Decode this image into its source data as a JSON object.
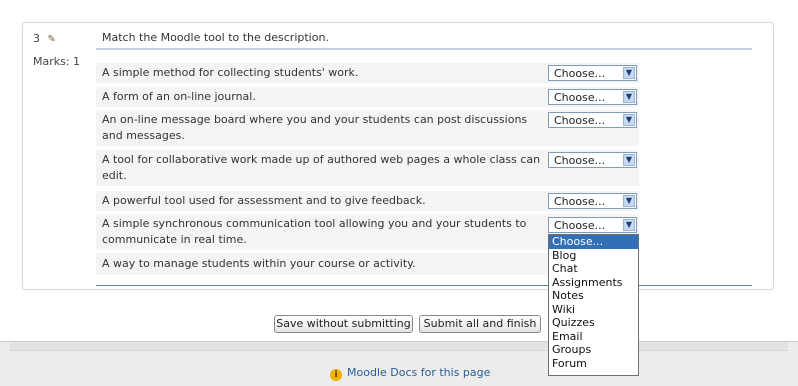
{
  "question": {
    "number": "3",
    "edit_icon": "pencil-icon",
    "marks_label": "Marks: 1",
    "text": "Match the Moodle tool to the description."
  },
  "items": [
    {
      "line1": "A simple method for collecting students' work.",
      "line2": "",
      "selected": "Choose..."
    },
    {
      "line1": "A form of an on-line journal.",
      "line2": "",
      "selected": "Choose..."
    },
    {
      "line1": "An on-line message board where you and your students can post discussions",
      "line2": "and messages.",
      "selected": "Choose..."
    },
    {
      "line1": "A tool for collaborative work made up of authored web pages a whole class can",
      "line2": "edit.",
      "selected": "Choose..."
    },
    {
      "line1": "A powerful tool used for assessment and to give feedback.",
      "line2": "",
      "selected": "Choose..."
    },
    {
      "line1": "A simple synchronous communication tool allowing you and your students to",
      "line2": "communicate in real time.",
      "selected": "Choose..."
    },
    {
      "line1": "A way to manage students within your course or activity.",
      "line2": "",
      "selected": ""
    }
  ],
  "dropdown": {
    "options": [
      "Choose...",
      "Blog",
      "Chat",
      "Assignments",
      "Notes",
      "Wiki",
      "Quizzes",
      "Email",
      "Groups",
      "Forum"
    ],
    "highlighted": "Choose..."
  },
  "buttons": {
    "save": "Save without submitting",
    "submit": "Submit all and finish"
  },
  "footer": {
    "docs_link": "Moodle Docs for this page",
    "docs_icon": "info-icon"
  },
  "colors": {
    "accent": "#5b7ac0",
    "dropdown_highlight": "#336eb8",
    "link": "#2a5c9a"
  }
}
